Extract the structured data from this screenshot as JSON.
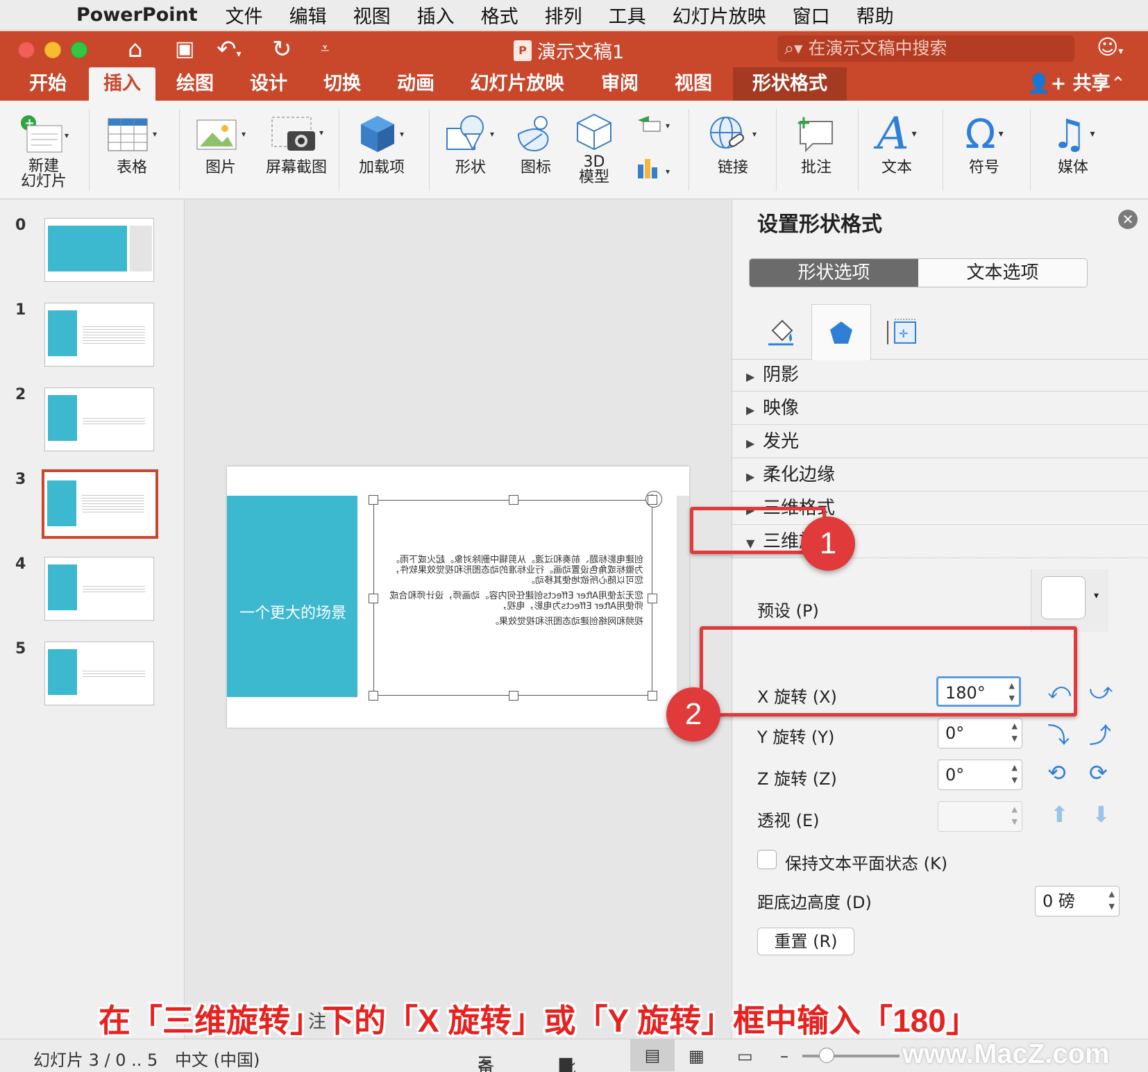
{
  "menubar": {
    "app": "PowerPoint",
    "items": [
      "文件",
      "编辑",
      "视图",
      "插入",
      "格式",
      "排列",
      "工具",
      "幻灯片放映",
      "窗口",
      "帮助"
    ]
  },
  "titlebar": {
    "doc_title": "演示文稿1",
    "search_placeholder": "在演示文稿中搜索",
    "doc_icon": "P"
  },
  "tabs": {
    "items": [
      "开始",
      "插入",
      "绘图",
      "设计",
      "切换",
      "动画",
      "幻灯片放映",
      "审阅",
      "视图",
      "形状格式"
    ],
    "active": "插入",
    "share": "共享"
  },
  "ribbon": {
    "new_slide": "新建\n幻灯片",
    "table": "表格",
    "picture": "图片",
    "screenshot": "屏幕截图",
    "addins": "加载项",
    "shapes": "形状",
    "icons": "图标",
    "model3d": "3D\n模型",
    "link": "链接",
    "comment": "批注",
    "text": "文本",
    "symbol": "符号",
    "media": "媒体"
  },
  "thumbnails": {
    "numbers": [
      "0",
      "1",
      "2",
      "3",
      "4",
      "5"
    ],
    "selected": "3"
  },
  "slide": {
    "title": "一个更大的场景",
    "mirrored_text": [
      "创建电影标题、前奏和过渡。从剪辑中删除对象。起火或下雨。为徽标或角色设置动画。行业标准的动态图形和视觉效果软件，您可以随心所欲地使其移动。",
      "您无法使用After Effects创建任何内容。动画师，设计师和合成师使用After Effects为电影，电视，",
      "视频和网络创建动态图形和视觉效果。"
    ]
  },
  "pane": {
    "title": "设置形状格式",
    "tab_shape": "形状选项",
    "tab_text": "文本选项",
    "sections": [
      "阴影",
      "映像",
      "发光",
      "柔化边缘",
      "三维格式",
      "三维旋转"
    ],
    "preset_label": "预设 (P)",
    "x_label": "X 旋转 (X)",
    "x_value": "180°",
    "y_label": "Y 旋转 (Y)",
    "y_value": "0°",
    "z_label": "Z 旋转 (Z)",
    "z_value": "0°",
    "persp_label": "透视 (E)",
    "persp_value": "",
    "keep_text_flat": "保持文本平面状态 (K)",
    "distance_label": "距底边高度 (D)",
    "distance_value": "0 磅",
    "reset": "重置 (R)"
  },
  "badges": {
    "one": "1",
    "two": "2"
  },
  "status": {
    "slide_info": "幻灯片 3 / 0 .. 5",
    "language": "中文 (中国)",
    "notes": "备注",
    "comments": "批注",
    "notes_placeholder": "注"
  },
  "caption": "在「三维旋转」下的「X 旋转」或「Y 旋转」框中输入「180」",
  "watermark": "www.MacZ.com",
  "colors": {
    "accent": "#c9472b",
    "teal": "#3cb8cf",
    "highlight": "#e03a3a"
  }
}
